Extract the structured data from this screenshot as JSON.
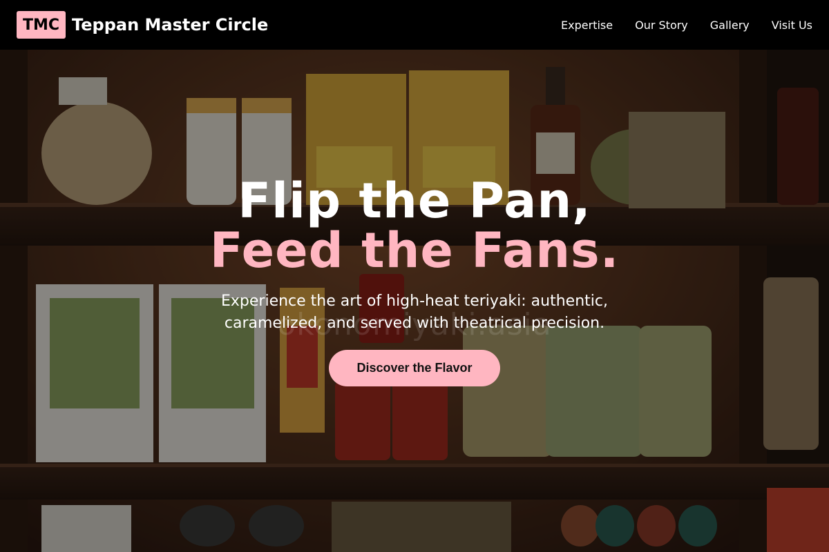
{
  "header": {
    "logo_badge": "TMC",
    "brand_name": "Teppan Master Circle",
    "nav": [
      {
        "label": "Expertise"
      },
      {
        "label": "Our Story"
      },
      {
        "label": "Gallery"
      },
      {
        "label": "Visit Us"
      }
    ]
  },
  "hero": {
    "title_line1": "Flip the Pan,",
    "title_line2": "Feed the Fans.",
    "subtitle": "Experience the art of high-heat teriyaki: authentic, caramelized, and served with theatrical precision.",
    "cta_label": "Discover the Flavor",
    "background_watermark": "okonomiyaki.asia"
  },
  "colors": {
    "accent": "#ffb6c1",
    "header_bg": "#000000",
    "text": "#ffffff"
  }
}
